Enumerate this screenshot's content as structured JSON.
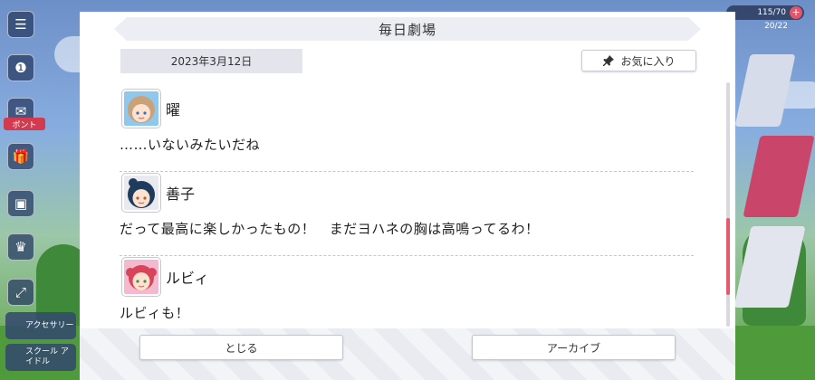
{
  "dialog": {
    "title": "毎日劇場",
    "date": "2023年3月12日",
    "favorite_label": "お気に入り",
    "entries": [
      {
        "speaker": "曜",
        "line": "……いないみたいだね",
        "avatar_color": "#c9a27a",
        "frame_color": "#8fc8ef"
      },
      {
        "speaker": "善子",
        "line": "だって最高に楽しかったもの！　まだヨハネの胸は高鳴ってるわ！",
        "avatar_color": "#1e3a5c",
        "frame_color": "#e9eaf0"
      },
      {
        "speaker": "ルビィ",
        "line": "ルビィも！",
        "avatar_color": "#d8455a",
        "frame_color": "#f3b9cf"
      }
    ],
    "close_label": "とじる",
    "archive_label": "アーカイブ",
    "scroll_position": 0.55
  },
  "background": {
    "left_tag": "ポント",
    "accessory_label": "アクセサリー",
    "school_idol_label": "スクール アイドル",
    "coin_label": "115/70",
    "sub_label": "20/22"
  }
}
